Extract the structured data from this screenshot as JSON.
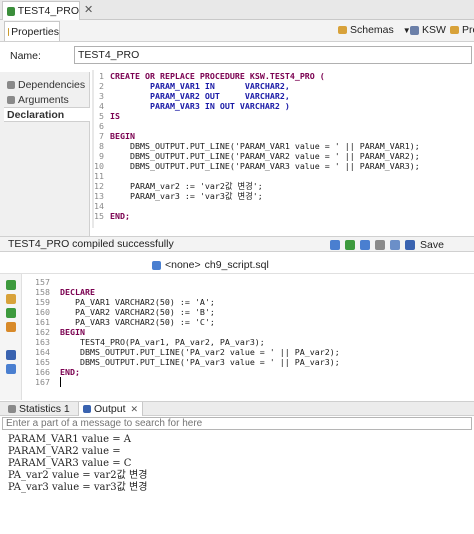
{
  "window": {
    "tab_title": "TEST4_PRO",
    "close_glyph": "✕"
  },
  "toolbar": {
    "properties_label": "Properties",
    "schemas_label": "Schemas",
    "ksw_label": "KSW",
    "pro_label": "Pro"
  },
  "name_row": {
    "label": "Name:",
    "value": "TEST4_PRO"
  },
  "side_tabs": {
    "dependencies": "Dependencies",
    "arguments": "Arguments",
    "declaration": "Declaration"
  },
  "editor_top": {
    "line_numbers": [
      "1",
      "2",
      "3",
      "4",
      "5",
      "6",
      "7",
      "8",
      "9",
      "10",
      "11",
      "12",
      "13",
      "14",
      "15"
    ],
    "lines": [
      "CREATE OR REPLACE PROCEDURE KSW.TEST4_PRO (",
      "        PARAM_VAR1 IN      VARCHAR2,",
      "        PARAM_VAR2 OUT     VARCHAR2,",
      "        PARAM_VAR3 IN OUT VARCHAR2 )",
      "IS",
      "",
      "BEGIN",
      "    DBMS_OUTPUT.PUT_LINE('PARAM_VAR1 value = ' || PARAM_VAR1);",
      "    DBMS_OUTPUT.PUT_LINE('PARAM_VAR2 value = ' || PARAM_VAR2);",
      "    DBMS_OUTPUT.PUT_LINE('PARAM_VAR3 value = ' || PARAM_VAR3);",
      "",
      "    PARAM_var2 := 'var2값 변경';",
      "    PARAM_var3 := 'var3값 변경';",
      "",
      "END;"
    ]
  },
  "status": {
    "compile_message": "TEST4_PRO compiled successfully",
    "save_label": "Save"
  },
  "script": {
    "connection": "<none>",
    "filename": "ch9_script.sql"
  },
  "editor_bottom": {
    "line_numbers": [
      "157",
      "158",
      "159",
      "160",
      "161",
      "162",
      "163",
      "164",
      "165",
      "166",
      "167"
    ],
    "lines": [
      "",
      "DECLARE",
      "   PA_VAR1 VARCHAR2(50) := 'A';",
      "   PA_VAR2 VARCHAR2(50) := 'B';",
      "   PA_VAR3 VARCHAR2(50) := 'C';",
      "BEGIN",
      "    TEST4_PRO(PA_var1, PA_var2, PA_var3);",
      "    DBMS_OUTPUT.PUT_LINE('PA_var2 value = ' || PA_var2);",
      "    DBMS_OUTPUT.PUT_LINE('PA_var3 value = ' || PA_var3);",
      "END;",
      ""
    ]
  },
  "output_tabs": {
    "statistics": "Statistics 1",
    "output": "Output"
  },
  "filter": {
    "placeholder": "Enter a part of a message to search for here"
  },
  "output_lines": [
    "PARAM_VAR1 value = A",
    "PARAM_VAR2 value =",
    "PARAM_VAR3 value = C",
    "PA_var2 value = var2값 변경",
    "PA_var3 value = var3값 변경"
  ],
  "colors": {
    "keyword": "#7a0050",
    "type": "#1a1aa6",
    "string": "#1b2ad6",
    "accent": "#2a6fd6"
  }
}
